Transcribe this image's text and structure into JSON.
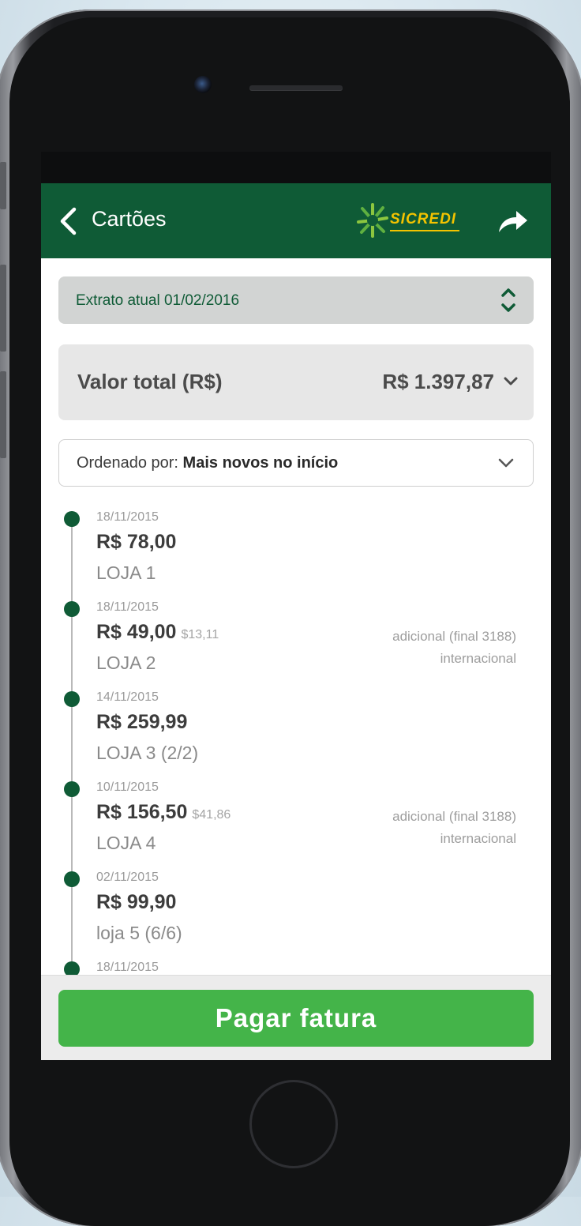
{
  "header": {
    "back_label": "Cartões",
    "logo_text": "SICREDI",
    "brand_color": "#0f5b36",
    "accent_color": "#f3c300"
  },
  "statement": {
    "selected": "Extrato atual 01/02/2016"
  },
  "total": {
    "label": "Valor total (R$)",
    "value": "R$ 1.397,87"
  },
  "sort": {
    "prefix": "Ordenado por:",
    "selected": "Mais novos no início"
  },
  "transactions": [
    {
      "date": "18/11/2015",
      "amount": "R$ 78,00",
      "foreign": "",
      "store": "LOJA 1",
      "card": "",
      "intl": ""
    },
    {
      "date": "18/11/2015",
      "amount": "R$ 49,00",
      "foreign": "$13,11",
      "store": "LOJA 2",
      "card": "adicional (final 3188)",
      "intl": "internacional"
    },
    {
      "date": "14/11/2015",
      "amount": "R$ 259,99",
      "foreign": "",
      "store": "LOJA 3 (2/2)",
      "card": "",
      "intl": ""
    },
    {
      "date": "10/11/2015",
      "amount": "R$ 156,50",
      "foreign": "$41,86",
      "store": "LOJA 4",
      "card": "adicional (final 3188)",
      "intl": "internacional"
    },
    {
      "date": "02/11/2015",
      "amount": "R$ 99,90",
      "foreign": "",
      "store": "loja 5 (6/6)",
      "card": "",
      "intl": ""
    },
    {
      "date": "18/11/2015",
      "amount": "",
      "foreign": "",
      "store": "",
      "card": "",
      "intl": ""
    }
  ],
  "footer": {
    "pay_label": "Pagar fatura",
    "pay_color": "#44b449"
  }
}
